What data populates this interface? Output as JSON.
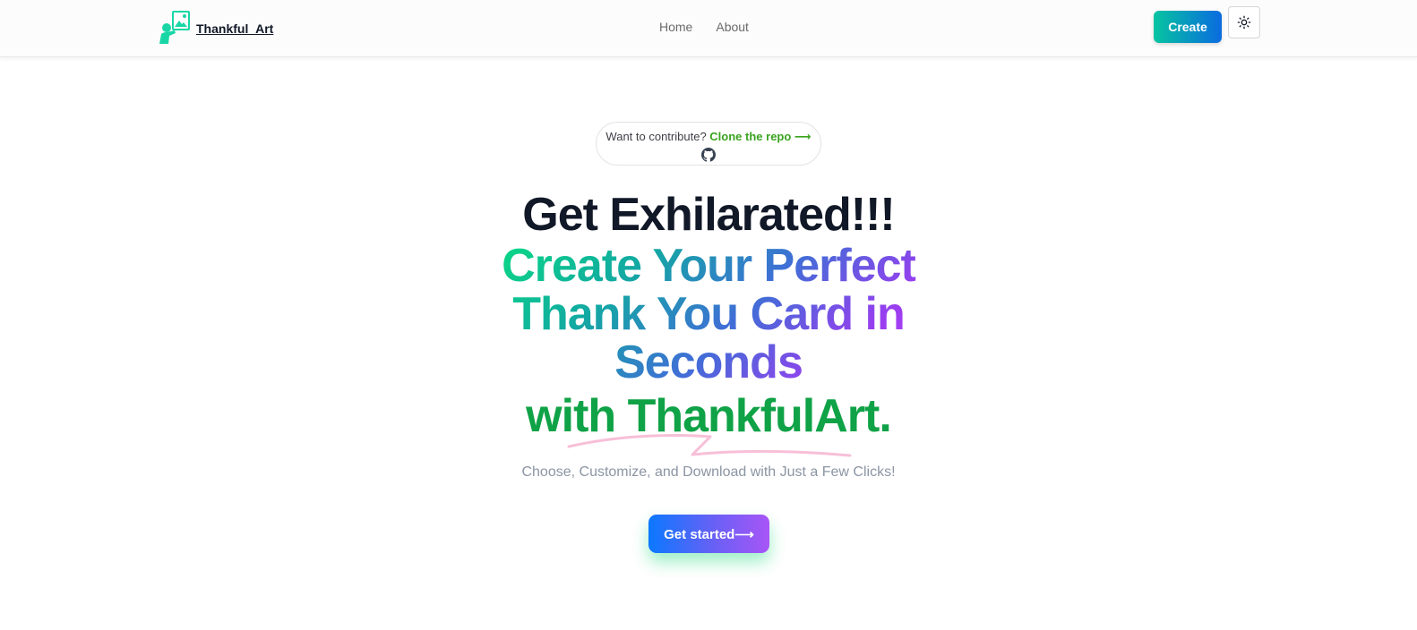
{
  "nav": {
    "brand": "Thankful_Art",
    "links": [
      "Home",
      "About"
    ],
    "create_label": "Create",
    "theme_icon": "sun-icon"
  },
  "contribute": {
    "prefix": "Want to contribute?",
    "link": "Clone the repo ⟶",
    "icon": "github-icon"
  },
  "hero": {
    "line1": "Get Exhilarated!!!",
    "line2": "Create Your Perfect Thank You Card in Seconds",
    "line3": "with ThankfulArt.",
    "subtitle": "Choose, Customize, and Download with Just a Few Clicks!",
    "cta": "Get started⟶"
  },
  "colors": {
    "brand_gradient_start": "#06c4a0",
    "brand_gradient_end": "#0a6be0",
    "link_green": "#3aa31f",
    "headline_green": "#0fa246",
    "cta_gradient_start": "#0b78ff",
    "cta_gradient_end": "#a855f7"
  }
}
